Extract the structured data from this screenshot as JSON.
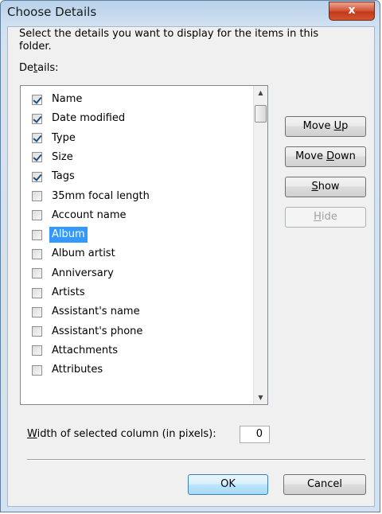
{
  "window": {
    "title": "Choose Details",
    "close_glyph": "x"
  },
  "instructions": "Select the details you want to display for the items in this folder.",
  "details_label": {
    "pre": "De",
    "key": "t",
    "post": "ails:"
  },
  "details_list": [
    {
      "label": "Name",
      "checked": true,
      "selected": false
    },
    {
      "label": "Date modified",
      "checked": true,
      "selected": false
    },
    {
      "label": "Type",
      "checked": true,
      "selected": false
    },
    {
      "label": "Size",
      "checked": true,
      "selected": false
    },
    {
      "label": "Tags",
      "checked": true,
      "selected": false
    },
    {
      "label": "35mm focal length",
      "checked": false,
      "selected": false
    },
    {
      "label": "Account name",
      "checked": false,
      "selected": false
    },
    {
      "label": "Album",
      "checked": false,
      "selected": true
    },
    {
      "label": "Album artist",
      "checked": false,
      "selected": false
    },
    {
      "label": "Anniversary",
      "checked": false,
      "selected": false
    },
    {
      "label": "Artists",
      "checked": false,
      "selected": false
    },
    {
      "label": "Assistant's name",
      "checked": false,
      "selected": false
    },
    {
      "label": "Assistant's phone",
      "checked": false,
      "selected": false
    },
    {
      "label": "Attachments",
      "checked": false,
      "selected": false
    },
    {
      "label": "Attributes",
      "checked": false,
      "selected": false
    }
  ],
  "buttons": {
    "move_up": {
      "pre": "Move ",
      "key": "U",
      "post": "p"
    },
    "move_down": {
      "pre": "Move ",
      "key": "D",
      "post": "own"
    },
    "show": {
      "pre": "",
      "key": "S",
      "post": "how"
    },
    "hide": {
      "pre": "",
      "key": "H",
      "post": "ide"
    },
    "ok": "OK",
    "cancel": "Cancel"
  },
  "width_field": {
    "label": {
      "pre": "",
      "key": "W",
      "post": "idth of selected column (in pixels):"
    },
    "value": "0"
  },
  "scrollbar": {
    "up_icon": "scroll-up-arrow-icon",
    "down_icon": "scroll-down-arrow-icon"
  },
  "colors": {
    "selection": "#3399ff",
    "checkmark": "#1c4f7c",
    "close_button": "#c23a1a"
  }
}
